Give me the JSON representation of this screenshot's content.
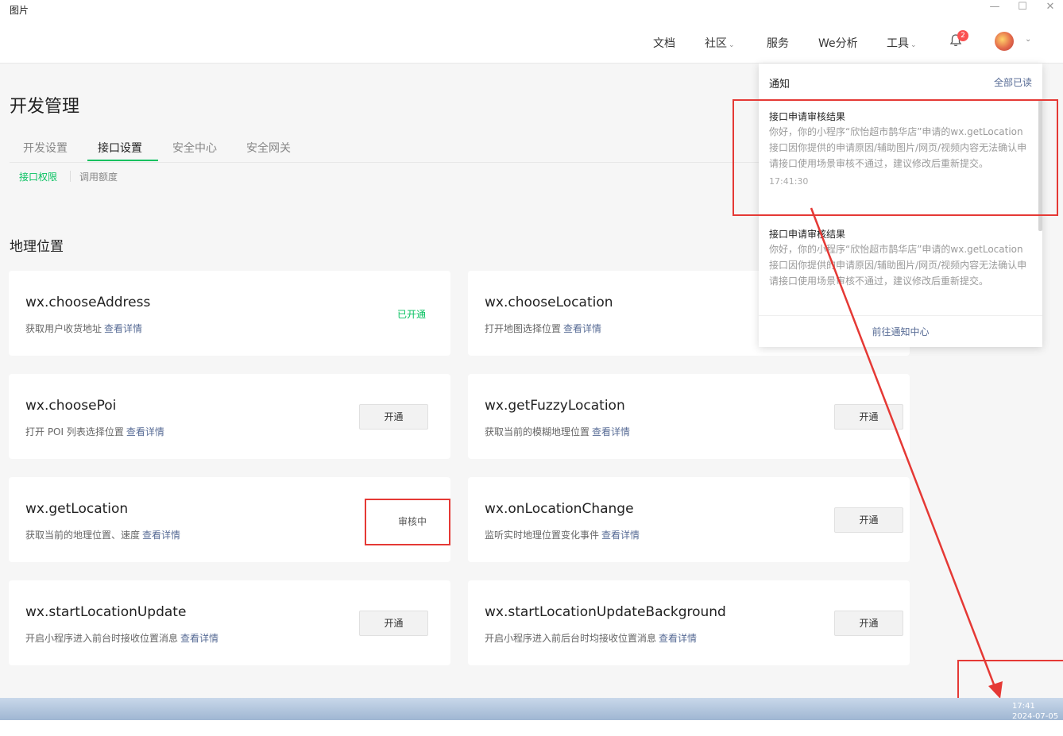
{
  "window": {
    "title": "图片",
    "controls": [
      "—",
      "☐",
      "✕"
    ]
  },
  "topnav": {
    "items": [
      {
        "label": "文档",
        "dropdown": false
      },
      {
        "label": "社区",
        "dropdown": true
      },
      {
        "label": "服务",
        "dropdown": false
      },
      {
        "label": "We分析",
        "dropdown": false
      },
      {
        "label": "工具",
        "dropdown": true
      }
    ],
    "notification_count": "2",
    "chevron": "⌄"
  },
  "page": {
    "title": "开发管理",
    "tabs": [
      "开发设置",
      "接口设置",
      "安全中心",
      "安全网关"
    ],
    "active_tab": 1,
    "subtabs": [
      "接口权限",
      "调用额度"
    ],
    "section_title": "地理位置"
  },
  "apis": [
    {
      "name": "wx.chooseAddress",
      "desc": "获取用户收货地址",
      "link": "查看详情",
      "action": "已开通",
      "state": "enabled"
    },
    {
      "name": "wx.chooseLocation",
      "desc": "打开地图选择位置",
      "link": "查看详情",
      "action": "",
      "state": "hidden"
    },
    {
      "name": "wx.choosePoi",
      "desc": "打开 POI 列表选择位置",
      "link": "查看详情",
      "action": "开通",
      "state": "button"
    },
    {
      "name": "wx.getFuzzyLocation",
      "desc": "获取当前的模糊地理位置",
      "link": "查看详情",
      "action": "开通",
      "state": "button"
    },
    {
      "name": "wx.getLocation",
      "desc": "获取当前的地理位置、速度",
      "link": "查看详情",
      "action": "审核中",
      "state": "reviewing"
    },
    {
      "name": "wx.onLocationChange",
      "desc": "监听实时地理位置变化事件",
      "link": "查看详情",
      "action": "开通",
      "state": "button"
    },
    {
      "name": "wx.startLocationUpdate",
      "desc": "开启小程序进入前台时接收位置消息",
      "link": "查看详情",
      "action": "开通",
      "state": "button"
    },
    {
      "name": "wx.startLocationUpdateBackground",
      "desc": "开启小程序进入前后台时均接收位置消息",
      "link": "查看详情",
      "action": "开通",
      "state": "button"
    }
  ],
  "notifications": {
    "title": "通知",
    "mark_all_read": "全部已读",
    "items": [
      {
        "title": "接口申请审核结果",
        "body": "你好，你的小程序“欣怡超市鹊华店”申请的wx.getLocation接口因你提供的申请原因/辅助图片/网页/视频内容无法确认申请接口使用场景审核不通过，建议修改后重新提交。",
        "time": "17:41:30"
      },
      {
        "title": "接口申请审核结果",
        "body": "你好，你的小程序“欣怡超市鹊华店”申请的wx.getLocation接口因你提供的申请原因/辅助图片/网页/视频内容无法确认申请接口使用场景审核不通过，建议修改后重新提交。",
        "time": ""
      }
    ],
    "footer_link": "前往通知中心"
  },
  "taskbar": {
    "time": "17:41",
    "date": "2024-07-05"
  },
  "colors": {
    "accent": "#07c160",
    "link": "#576b95",
    "annotation": "#e53935"
  }
}
